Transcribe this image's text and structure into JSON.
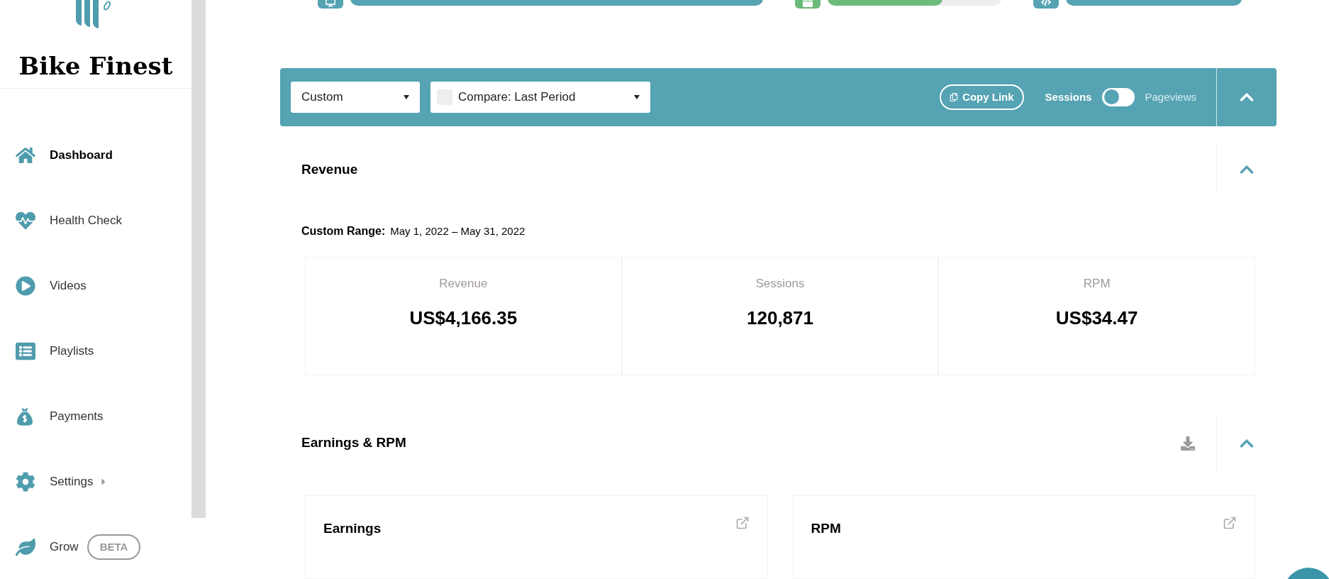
{
  "sidebar": {
    "brand": "Bike Finest",
    "items": [
      {
        "label": "Dashboard",
        "selected": true
      },
      {
        "label": "Health Check",
        "selected": false
      },
      {
        "label": "Videos",
        "selected": false
      },
      {
        "label": "Playlists",
        "selected": false
      },
      {
        "label": "Payments",
        "selected": false
      },
      {
        "label": "Settings",
        "selected": false,
        "submenu": true
      },
      {
        "label": "Grow",
        "selected": false,
        "badge": "BETA"
      }
    ]
  },
  "progress": [
    {
      "color": "#55a3b3",
      "level": 1
    },
    {
      "color": "#6dbb7b",
      "level": 0.66
    },
    {
      "color": "#55a3b3",
      "level": 1
    }
  ],
  "filter_bar": {
    "range": "Custom",
    "compare": {
      "label": "Compare: Last Period",
      "checked": false
    },
    "copy_link": "Copy Link",
    "toggle": {
      "left": "Sessions",
      "right": "Pageviews",
      "on": false
    }
  },
  "revenue": {
    "title": "Revenue",
    "range_label": "Custom Range:",
    "range": "May 1, 2022 – May 31, 2022",
    "metrics": [
      {
        "label": "Revenue",
        "value": "US$4,166.35"
      },
      {
        "label": "Sessions",
        "value": "120,871"
      },
      {
        "label": "RPM",
        "value": "US$34.47"
      }
    ]
  },
  "earnings": {
    "title": "Earnings & RPM",
    "cards": [
      {
        "title": "Earnings"
      },
      {
        "title": "RPM"
      }
    ]
  }
}
